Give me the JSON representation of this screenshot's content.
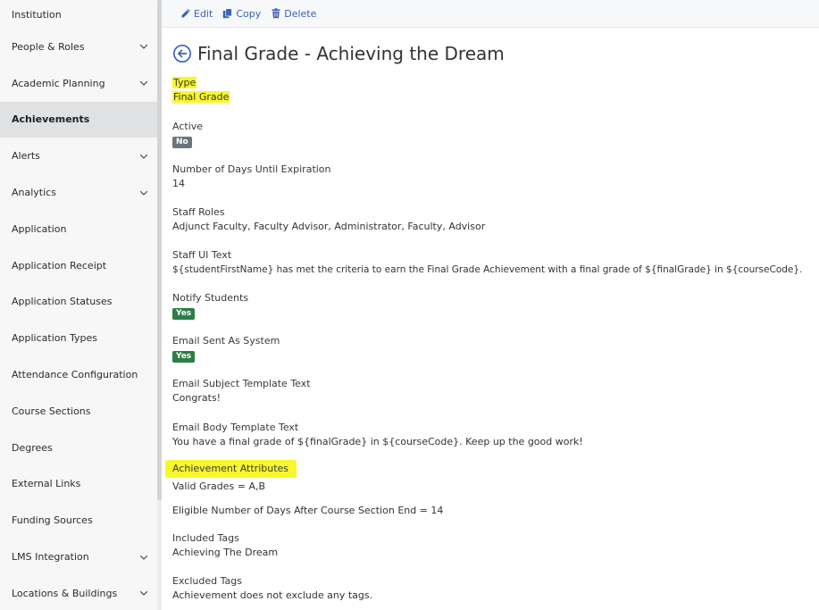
{
  "sidebar": {
    "items": [
      {
        "label": "Institution",
        "chevron": false,
        "active": false
      },
      {
        "label": "People & Roles",
        "chevron": true,
        "active": false
      },
      {
        "label": "Academic Planning",
        "chevron": true,
        "active": false
      },
      {
        "label": "Achievements",
        "chevron": false,
        "active": true
      },
      {
        "label": "Alerts",
        "chevron": true,
        "active": false
      },
      {
        "label": "Analytics",
        "chevron": true,
        "active": false
      },
      {
        "label": "Application",
        "chevron": false,
        "active": false
      },
      {
        "label": "Application Receipt",
        "chevron": false,
        "active": false
      },
      {
        "label": "Application Statuses",
        "chevron": false,
        "active": false
      },
      {
        "label": "Application Types",
        "chevron": false,
        "active": false
      },
      {
        "label": "Attendance Configuration",
        "chevron": false,
        "active": false
      },
      {
        "label": "Course Sections",
        "chevron": false,
        "active": false
      },
      {
        "label": "Degrees",
        "chevron": false,
        "active": false
      },
      {
        "label": "External Links",
        "chevron": false,
        "active": false
      },
      {
        "label": "Funding Sources",
        "chevron": false,
        "active": false
      },
      {
        "label": "LMS Integration",
        "chevron": true,
        "active": false
      },
      {
        "label": "Locations & Buildings",
        "chevron": true,
        "active": false
      }
    ]
  },
  "toolbar": {
    "edit_label": "Edit",
    "copy_label": "Copy",
    "delete_label": "Delete"
  },
  "page": {
    "title": "Final Grade - Achieving the Dream"
  },
  "fields": {
    "type": {
      "label": "Type",
      "value": "Final Grade"
    },
    "active": {
      "label": "Active",
      "badge": "No"
    },
    "expiration": {
      "label": "Number of Days Until Expiration",
      "value": "14"
    },
    "staff_roles": {
      "label": "Staff Roles",
      "value": "Adjunct Faculty, Faculty Advisor, Administrator, Faculty, Advisor"
    },
    "staff_ui_text": {
      "label": "Staff UI Text",
      "value": "${studentFirstName} has met the criteria to earn the Final Grade Achievement with a final grade of ${finalGrade} in ${courseCode}."
    },
    "notify_students": {
      "label": "Notify Students",
      "badge": "Yes"
    },
    "email_sent_as_system": {
      "label": "Email Sent As System",
      "badge": "Yes"
    },
    "email_subject": {
      "label": "Email Subject Template Text",
      "value": "Congrats!"
    },
    "email_body": {
      "label": "Email Body Template Text",
      "value": "You have a final grade of ${finalGrade} in ${courseCode}. Keep up the good work!"
    },
    "achievement_attributes": {
      "label": "Achievement Attributes",
      "values": [
        "Valid Grades = A,B",
        "Eligible Number of Days After Course Section End = 14"
      ]
    },
    "included_tags": {
      "label": "Included Tags",
      "value": "Achieving The Dream"
    },
    "excluded_tags": {
      "label": "Excluded Tags",
      "value": "Achievement does not exclude any tags."
    }
  },
  "colors": {
    "highlight": "#f8f72b",
    "link": "#3a62b3",
    "badge_no": "#6c757d",
    "badge_yes": "#2e7d46",
    "sidebar_active": "#dfe1e3"
  }
}
